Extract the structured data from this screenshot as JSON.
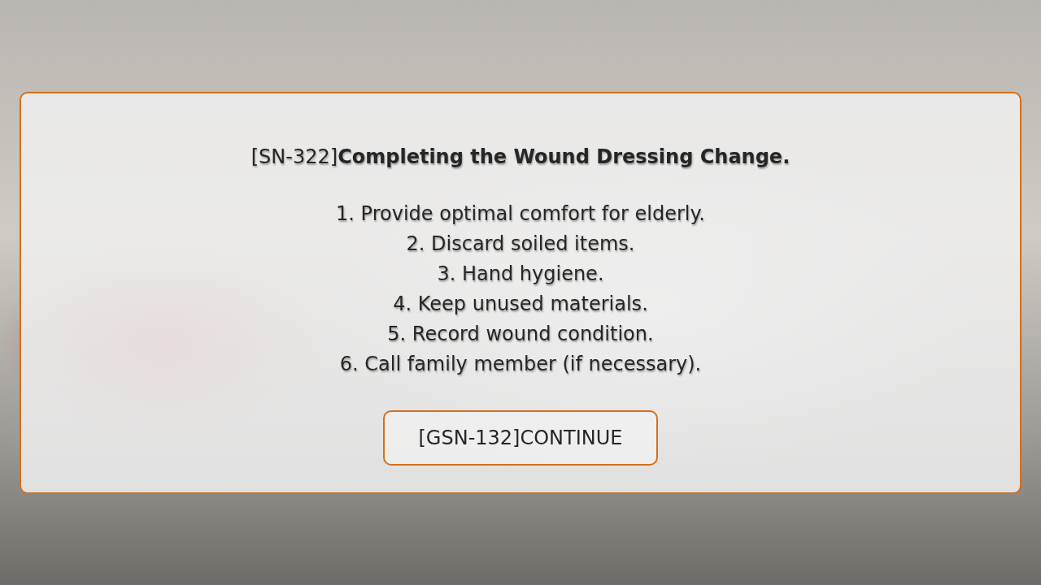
{
  "dialog": {
    "title": "[SN-322]**Completing the Wound Dressing Change.**",
    "steps": [
      "1. Provide optimal comfort for elderly.",
      "2. Discard soiled items.",
      "3. Hand hygiene.",
      "4. Keep unused materials.",
      "5. Record wound condition.",
      "6. Call family member (if necessary)."
    ],
    "button": "[GSN-132]CONTINUE"
  }
}
